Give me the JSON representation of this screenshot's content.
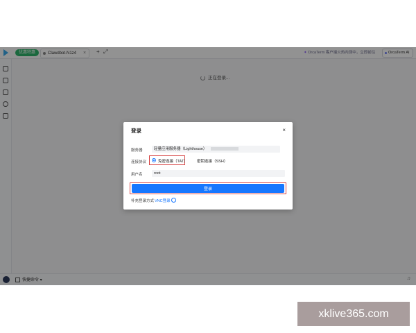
{
  "topbar": {
    "env_pill": "优惠特惠",
    "tab_label": "Clawdbot-N1z4",
    "banner": "OrcaTerm 客户端火热内测中，立即前往",
    "ai_button": "OrcaTerm AI"
  },
  "main": {
    "loading_text": "正在登录..."
  },
  "status": {
    "text": "快捷命令"
  },
  "modal": {
    "title": "登录",
    "server_label": "服务器",
    "server_value": "轻量应用服务器（Lighthouse）",
    "protocol_label": "连接协议",
    "option_tat": "免密连接（TAT）",
    "option_ssh": "密钥连接（SSH）",
    "username_label": "用户名",
    "username_value": "root",
    "login_button": "登录",
    "extra_label": "补充登录方式",
    "vnc_link": "VNC登录"
  },
  "watermark": "xklive365.com",
  "colors": {
    "primary": "#1677ff",
    "highlight_border": "#d64545"
  }
}
